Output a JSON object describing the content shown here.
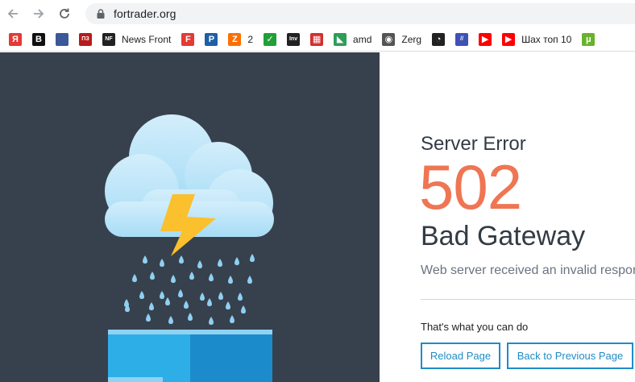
{
  "browser": {
    "url": "fortrader.org",
    "bookmarks": [
      {
        "icon": "yandex-icon",
        "glyph": "Я",
        "color": "#e53935",
        "label": ""
      },
      {
        "icon": "b-letter-icon",
        "glyph": "B",
        "color": "#111111",
        "label": ""
      },
      {
        "icon": "chart-site-icon",
        "glyph": "",
        "color": "#3b5998",
        "label": ""
      },
      {
        "icon": "p3-icon",
        "glyph": "ПЗ",
        "color": "#b71c1c",
        "label": ""
      },
      {
        "icon": "news-front-icon",
        "glyph": "NF",
        "color": "#222222",
        "label": "News Front"
      },
      {
        "icon": "fb-icon",
        "glyph": "F",
        "color": "#e53935",
        "label": ""
      },
      {
        "icon": "p-letter-icon",
        "glyph": "P",
        "color": "#1e5fa8",
        "label": ""
      },
      {
        "icon": "z-icon",
        "glyph": "Z",
        "color": "#ff6f00",
        "label": "2"
      },
      {
        "icon": "sber-icon",
        "glyph": "✓",
        "color": "#21a038",
        "label": ""
      },
      {
        "icon": "inv-icon",
        "glyph": "Inv",
        "color": "#222222",
        "label": ""
      },
      {
        "icon": "building-icon",
        "glyph": "▦",
        "color": "#d32f2f",
        "label": ""
      },
      {
        "icon": "amd-icon",
        "glyph": "◣",
        "color": "#2e9e57",
        "label": "amd"
      },
      {
        "icon": "globe-icon",
        "glyph": "◉",
        "color": "#555555",
        "label": "Zerg"
      },
      {
        "icon": "gauge-icon",
        "glyph": "◔",
        "color": "#222222",
        "label": ""
      },
      {
        "icon": "slashes-icon",
        "glyph": "//",
        "color": "#3f51b5",
        "label": ""
      },
      {
        "icon": "youtube-icon",
        "glyph": "▶",
        "color": "#ff0000",
        "label": ""
      },
      {
        "icon": "youtube-icon",
        "glyph": "▶",
        "color": "#ff0000",
        "label": "Шах топ 10"
      },
      {
        "icon": "utorrent-icon",
        "glyph": "μ",
        "color": "#6ab22e",
        "label": ""
      }
    ]
  },
  "error": {
    "label": "Server Error",
    "code": "502",
    "title": "Bad Gateway",
    "description": "Web server received an invalid response while acting as a gateway or proxy.",
    "suggestion": "That's what you can do",
    "reload_label": "Reload Page",
    "back_label": "Back to Previous Page"
  },
  "colors": {
    "panel_bg": "#37414d",
    "accent_code": "#ef7553",
    "button_border": "#1f8cc7"
  }
}
